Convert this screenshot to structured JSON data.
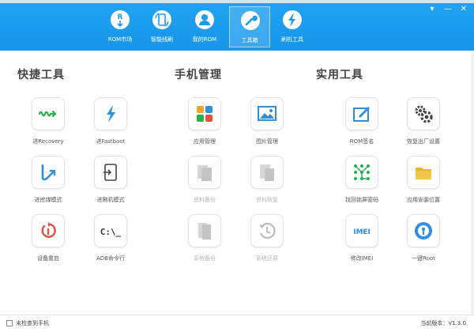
{
  "window": {
    "controls": [
      {
        "name": "menu-icon",
        "glyph": "▾"
      },
      {
        "name": "minimize-icon",
        "glyph": "—"
      },
      {
        "name": "close-icon",
        "glyph": "✕"
      }
    ]
  },
  "nav": {
    "items": [
      {
        "label": "ROM市场",
        "icon": "rom-market-icon"
      },
      {
        "label": "智能线刷",
        "icon": "smart-flash-icon"
      },
      {
        "label": "我的ROM",
        "icon": "my-rom-icon"
      },
      {
        "label": "工具箱",
        "icon": "toolbox-icon",
        "active": true
      },
      {
        "label": "刷机工具",
        "icon": "flash-tool-icon"
      }
    ]
  },
  "sections": [
    {
      "title": "快捷工具",
      "tools": [
        {
          "label": "进Recovery",
          "icon": "recovery-icon",
          "enabled": true
        },
        {
          "label": "进Fastboot",
          "icon": "fastboot-icon",
          "enabled": true
        },
        {
          "label": "进挖煤模式",
          "icon": "mining-mode-icon",
          "enabled": true
        },
        {
          "label": "进刷机模式",
          "icon": "flash-mode-icon",
          "enabled": true
        },
        {
          "label": "设备重启",
          "icon": "reboot-icon",
          "enabled": true
        },
        {
          "label": "ADB命令行",
          "icon": "adb-console-icon",
          "enabled": true
        }
      ]
    },
    {
      "title": "手机管理",
      "tools": [
        {
          "label": "应用管理",
          "icon": "app-manage-icon",
          "enabled": true
        },
        {
          "label": "图片管理",
          "icon": "image-manage-icon",
          "enabled": true
        },
        {
          "label": "资料备份",
          "icon": "data-backup-icon",
          "enabled": false
        },
        {
          "label": "资料恢复",
          "icon": "data-restore-icon",
          "enabled": false
        },
        {
          "label": "系统备份",
          "icon": "system-backup-icon",
          "enabled": false
        },
        {
          "label": "系统还原",
          "icon": "system-restore-icon",
          "enabled": false
        }
      ]
    },
    {
      "title": "实用工具",
      "tools": [
        {
          "label": "ROM签名",
          "icon": "rom-sign-icon",
          "enabled": true
        },
        {
          "label": "恢复出厂设置",
          "icon": "factory-reset-icon",
          "enabled": true
        },
        {
          "label": "找回锁屏密码",
          "icon": "unlock-pattern-icon",
          "enabled": true
        },
        {
          "label": "应用安装位置",
          "icon": "install-location-icon",
          "enabled": true
        },
        {
          "label": "修改IMEI",
          "icon": "imei-icon",
          "enabled": true
        },
        {
          "label": "一键Root",
          "icon": "root-icon",
          "enabled": true
        }
      ]
    }
  ],
  "footer": {
    "status": "未检查到手机",
    "version": "当前版本：V1.3.0"
  },
  "colors": {
    "header": "#1b9bed",
    "green": "#27b14a",
    "blue": "#2d8fe0",
    "red": "#e65040",
    "gray": "#c4c4c4"
  }
}
